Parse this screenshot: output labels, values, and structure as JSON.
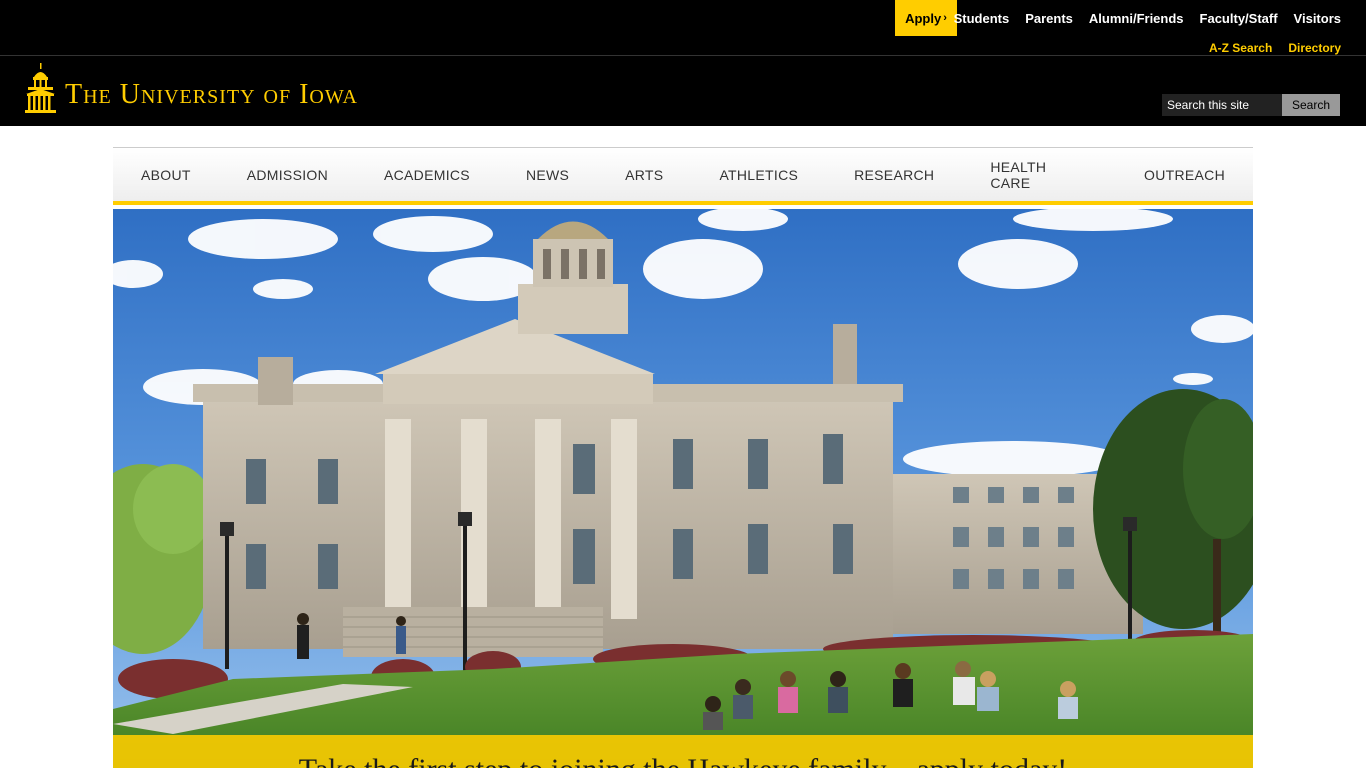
{
  "topbar": {
    "apply_label": "Apply",
    "apply_chevron": "›",
    "audience_links": [
      "Students",
      "Parents",
      "Alumni/Friends",
      "Faculty/Staff",
      "Visitors"
    ],
    "quick_links": [
      "A-Z Search",
      "Directory"
    ]
  },
  "masthead": {
    "logo_icon": "old-capitol-dome-icon",
    "wordmark": "The University of Iowa"
  },
  "search": {
    "placeholder": "Search this site",
    "button_label": "Search"
  },
  "nav": {
    "items": [
      "About",
      "Admission",
      "Academics",
      "News",
      "Arts",
      "Athletics",
      "Research",
      "Health Care",
      "Outreach"
    ]
  },
  "hero": {
    "image": "old-capitol-building-with-students-on-lawn",
    "banner_text": "Take the first step to joining the Hawkeye family—apply today!"
  },
  "colors": {
    "brand_gold": "#FFCD00",
    "black": "#000000"
  }
}
